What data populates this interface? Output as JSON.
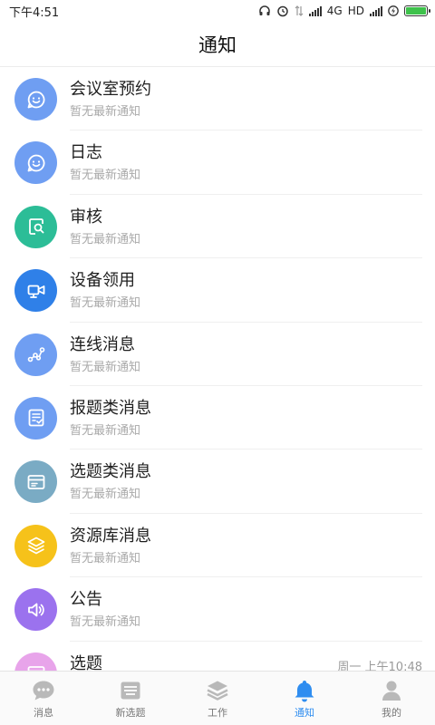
{
  "status_bar": {
    "time": "下午4:51",
    "network": "4G",
    "hd": "HD",
    "battery_level": 1.0
  },
  "header": {
    "title": "通知"
  },
  "notifications": [
    {
      "title": "会议室预约",
      "subtitle": "暂无最新通知",
      "time": "",
      "icon": "smiley-icon",
      "color": "#6f9ef2"
    },
    {
      "title": "日志",
      "subtitle": "暂无最新通知",
      "time": "",
      "icon": "smiley-icon",
      "color": "#6f9ef2"
    },
    {
      "title": "审核",
      "subtitle": "暂无最新通知",
      "time": "",
      "icon": "search-document-icon",
      "color": "#2cbd97"
    },
    {
      "title": "设备领用",
      "subtitle": "暂无最新通知",
      "time": "",
      "icon": "video-camera-icon",
      "color": "#2f80e8"
    },
    {
      "title": "连线消息",
      "subtitle": "暂无最新通知",
      "time": "",
      "icon": "connection-graph-icon",
      "color": "#6f9ef2"
    },
    {
      "title": "报题类消息",
      "subtitle": "暂无最新通知",
      "time": "",
      "icon": "checklist-icon",
      "color": "#6f9ef2"
    },
    {
      "title": "选题类消息",
      "subtitle": "暂无最新通知",
      "time": "",
      "icon": "window-icon",
      "color": "#7aabc4"
    },
    {
      "title": "资源库消息",
      "subtitle": "暂无最新通知",
      "time": "",
      "icon": "layers-icon",
      "color": "#f6c21a"
    },
    {
      "title": "公告",
      "subtitle": "暂无最新通知",
      "time": "",
      "icon": "speaker-icon",
      "color": "#9b72ee"
    },
    {
      "title": "选题",
      "subtitle": "",
      "time": "周一 上午10:48",
      "icon": "window-icon",
      "color": "#e8a4ea"
    }
  ],
  "tabs": [
    {
      "label": "消息",
      "icon": "chat-bubble-icon",
      "active": false
    },
    {
      "label": "新选题",
      "icon": "inbox-icon",
      "active": false
    },
    {
      "label": "工作",
      "icon": "layers-icon",
      "active": false
    },
    {
      "label": "通知",
      "icon": "bell-icon",
      "active": true
    },
    {
      "label": "我的",
      "icon": "person-icon",
      "active": false
    }
  ],
  "colors": {
    "tab_active": "#2f8df0",
    "tab_inactive": "#b9b9b9"
  }
}
